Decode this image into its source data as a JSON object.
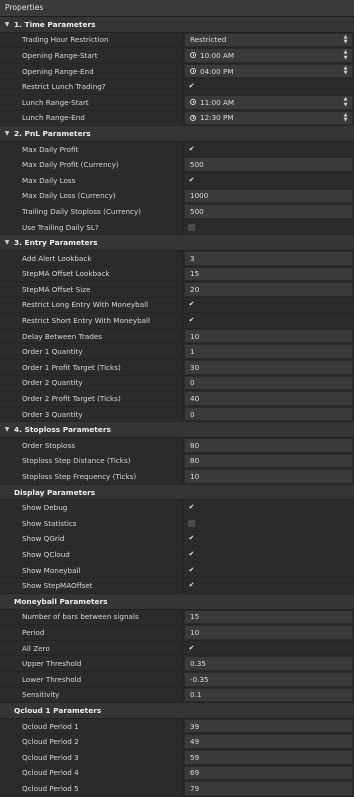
{
  "panel_title": "Properties",
  "sections": [
    {
      "title": "1. Time Parameters",
      "rows": [
        {
          "label": "Trading Hour Restriction",
          "type": "select",
          "value": "Restricted"
        },
        {
          "label": "Opening Range-Start",
          "type": "time",
          "value": "10:00 AM"
        },
        {
          "label": "Opening Range-End",
          "type": "time",
          "value": "04:00 PM"
        },
        {
          "label": "Restrict Lunch Trading?",
          "type": "check",
          "checked": true
        },
        {
          "label": "Lunch Range-Start",
          "type": "time",
          "value": "11:00 AM"
        },
        {
          "label": "Lunch Range-End",
          "type": "time",
          "value": "12:30 PM"
        }
      ]
    },
    {
      "title": "2. PnL Parameters",
      "rows": [
        {
          "label": "Max Daily Profit",
          "type": "check",
          "checked": true
        },
        {
          "label": "Max Daily Profit (Currency)",
          "type": "text",
          "value": "500"
        },
        {
          "label": "Max Daily Loss",
          "type": "check",
          "checked": true
        },
        {
          "label": "Max Daily Loss (Currency)",
          "type": "text",
          "value": "1000"
        },
        {
          "label": "Trailing Daily Stoploss (Currency)",
          "type": "text",
          "value": "500"
        },
        {
          "label": "Use Trailing Daily SL?",
          "type": "check",
          "checked": false
        }
      ]
    },
    {
      "title": "3. Entry Parameters",
      "rows": [
        {
          "label": "Add Alert Lookback",
          "type": "text",
          "value": "3"
        },
        {
          "label": "StepMA Offset Lookback",
          "type": "text",
          "value": "15"
        },
        {
          "label": "StepMA Offset Size",
          "type": "text",
          "value": "20"
        },
        {
          "label": "Restrict Long Entry With Moneyball",
          "type": "check",
          "checked": true
        },
        {
          "label": "Restrict Short Entry With Moneyball",
          "type": "check",
          "checked": true
        },
        {
          "label": "Delay Between Trades",
          "type": "text",
          "value": "10"
        },
        {
          "label": "Order 1 Quantity",
          "type": "text",
          "value": "1"
        },
        {
          "label": "Order 1 Profit Target (Ticks)",
          "type": "text",
          "value": "30"
        },
        {
          "label": "Order 2 Quantity",
          "type": "text",
          "value": "0"
        },
        {
          "label": "Order 2 Profit Target (Ticks)",
          "type": "text",
          "value": "40"
        },
        {
          "label": "Order 3 Quantity",
          "type": "text",
          "value": "0"
        }
      ]
    },
    {
      "title": "4. Stoploss Parameters",
      "rows": [
        {
          "label": "Order Stoploss",
          "type": "text",
          "value": "80"
        },
        {
          "label": "Stoploss Step Distance (Ticks)",
          "type": "text",
          "value": "80"
        },
        {
          "label": "Stoploss Step Frequency (Ticks)",
          "type": "text",
          "value": "10"
        }
      ]
    },
    {
      "title": "Display Parameters",
      "rows": [
        {
          "label": "Show Debug",
          "type": "check",
          "checked": true
        },
        {
          "label": "Show Statistics",
          "type": "check",
          "checked": false
        },
        {
          "label": "Show QGrid",
          "type": "check",
          "checked": true
        },
        {
          "label": "Show QCloud",
          "type": "check",
          "checked": true
        },
        {
          "label": "Show Moneyball",
          "type": "check",
          "checked": true
        },
        {
          "label": "Show StepMAOffset",
          "type": "check",
          "checked": true
        }
      ]
    },
    {
      "title": "Moneyball Parameters",
      "rows": [
        {
          "label": "Number of bars between signals",
          "type": "text",
          "value": "15"
        },
        {
          "label": "Period",
          "type": "text",
          "value": "10"
        },
        {
          "label": "All Zero",
          "type": "check",
          "checked": true
        },
        {
          "label": "Upper Threshold",
          "type": "text",
          "value": "0.35"
        },
        {
          "label": "Lower Threshold",
          "type": "text",
          "value": "-0.35"
        },
        {
          "label": "Sensitivity",
          "type": "text",
          "value": "0.1"
        }
      ]
    },
    {
      "title": "Qcloud 1 Parameters",
      "rows": [
        {
          "label": "Qcloud Period 1",
          "type": "text",
          "value": "39"
        },
        {
          "label": "Qcloud Period 2",
          "type": "text",
          "value": "49"
        },
        {
          "label": "Qcloud Period 3",
          "type": "text",
          "value": "59"
        },
        {
          "label": "Qcloud Period 4",
          "type": "text",
          "value": "69"
        },
        {
          "label": "Qcloud Period 5",
          "type": "text",
          "value": "79"
        }
      ]
    }
  ],
  "icons": {
    "expand": "chevron-down-icon",
    "check": "checkmark-icon",
    "time": "clock-icon",
    "spin": "spinner-arrows-icon"
  },
  "colors": {
    "background": "#2b2b2b",
    "section_bg": "#353535",
    "input_bg": "#3a3a3a",
    "text": "#d7d7d7"
  }
}
